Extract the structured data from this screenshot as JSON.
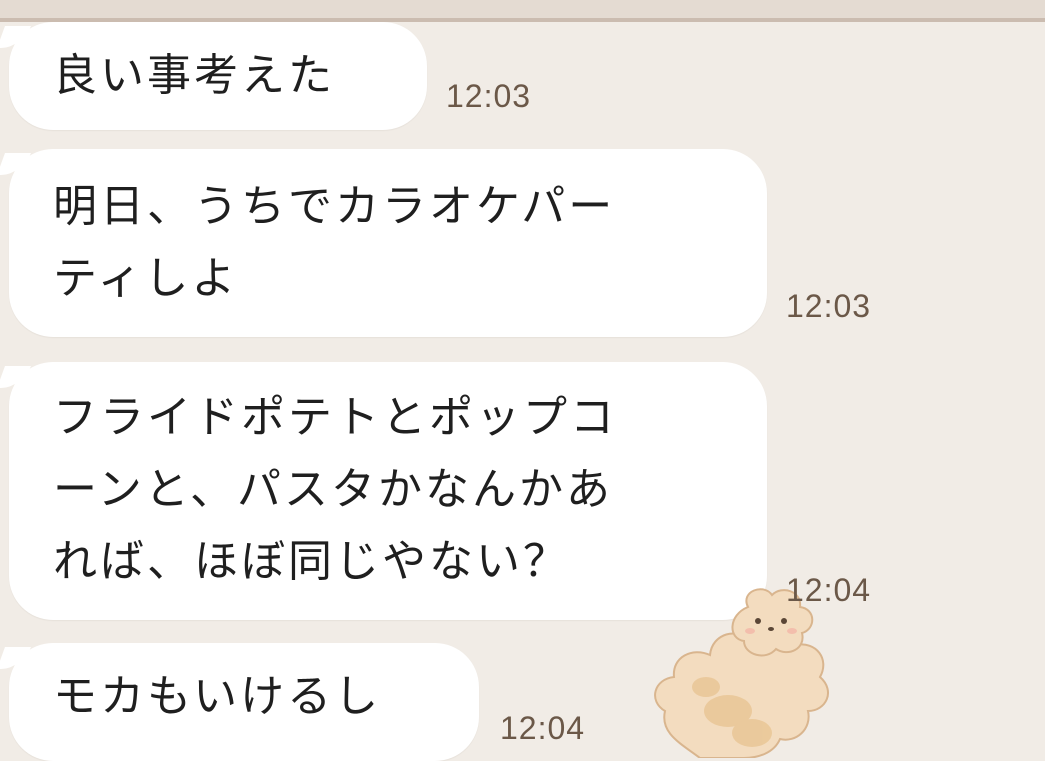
{
  "messages": [
    {
      "text": "良い事考えた",
      "time": "12:03"
    },
    {
      "lines": [
        "明日、うちでカラオケパー",
        "ティしよ"
      ],
      "time": "12:03"
    },
    {
      "lines": [
        "フライドポテトとポップコ",
        "ーンと、パスタかなんかあ",
        "れば、ほぼ同じやない？"
      ],
      "time": "12:04"
    },
    {
      "text": "モカもいけるし",
      "time": "12:04"
    }
  ],
  "sticker": {
    "icon": "fluffy-dog-sticker-icon"
  },
  "colors": {
    "background": "#f1ece6",
    "bubble": "#ffffff",
    "timestamp": "#6b5848",
    "text": "#1f1f1f"
  }
}
